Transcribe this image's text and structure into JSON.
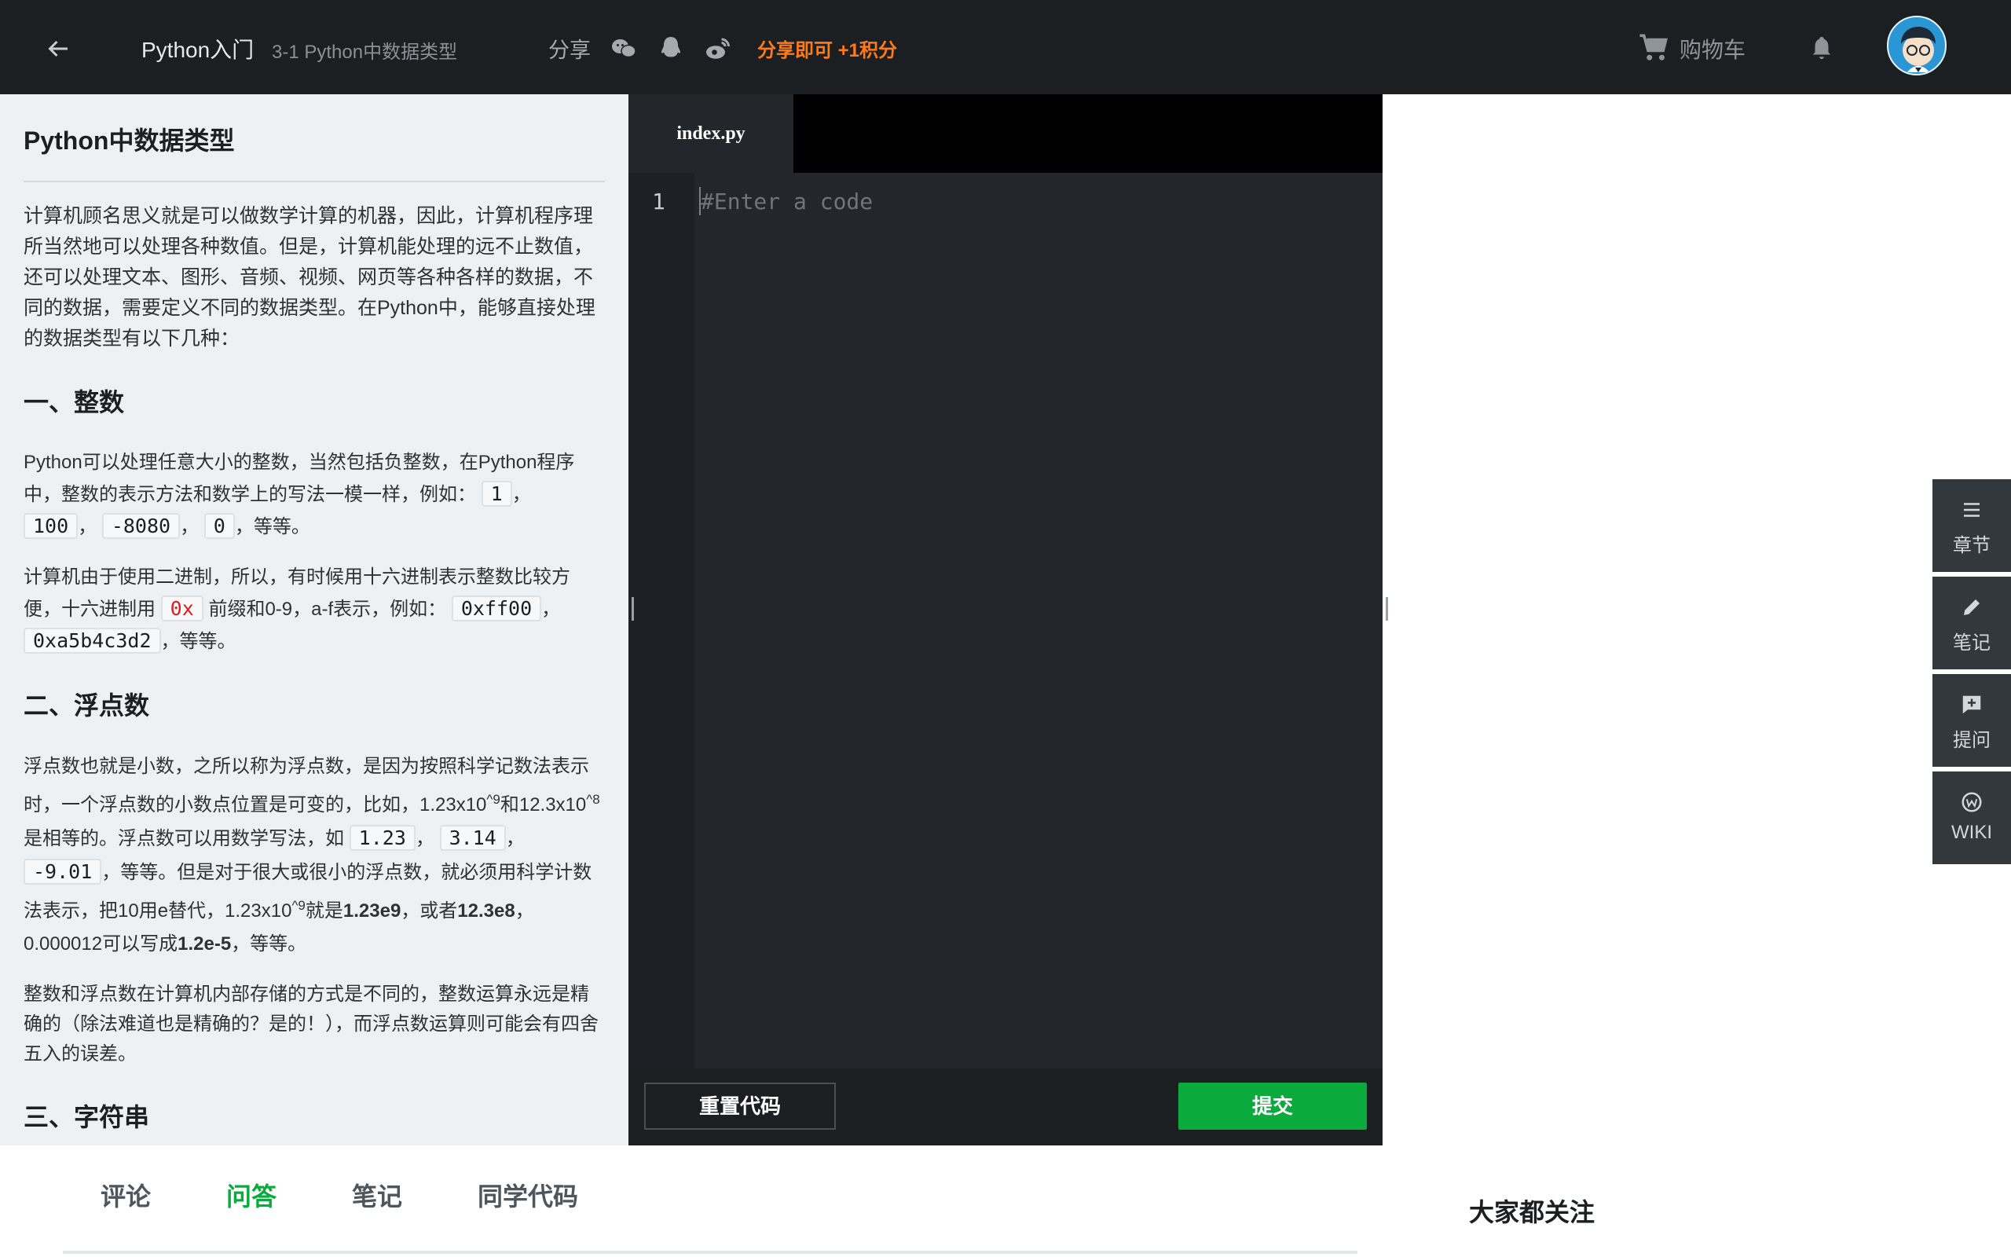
{
  "header": {
    "course_title": "Python入门",
    "lesson_subtitle": "3-1 Python中数据类型",
    "share_label": "分享",
    "share_promo": "分享即可 +1积分",
    "cart_label": "购物车"
  },
  "lesson": {
    "title": "Python中数据类型",
    "intro": "计算机顾名思义就是可以做数学计算的机器，因此，计算机程序理所当然地可以处理各种数值。但是，计算机能处理的远不止数值，还可以处理文本、图形、音频、视频、网页等各种各样的数据，不同的数据，需要定义不同的数据类型。在Python中，能够直接处理的数据类型有以下几种：",
    "h_int": "一、整数",
    "int_p1_a": "Python可以处理任意大小的整数，当然包括负整数，在Python程序中，整数的表示方法和数学上的写法一模一样，例如：",
    "int_codes": [
      "1",
      "100",
      "-8080",
      "0"
    ],
    "int_p1_end": "，等等。",
    "int_p2_a": "计算机由于使用二进制，所以，有时候用十六进制表示整数比较方便，十六进制用",
    "hex_prefix": "0x",
    "int_p2_b": "前缀和0-9，a-f表示，例如：",
    "hex_codes": [
      "0xff00",
      "0xa5b4c3d2"
    ],
    "int_p2_end": "，等等。",
    "h_float": "二、浮点数",
    "float_p1_a": "浮点数也就是小数，之所以称为浮点数，是因为按照科学记数法表示时，一个浮点数的小数点位置是可变的，比如，1.23x10",
    "sup_9": "^9",
    "float_p1_b": "和12.3x10",
    "sup_8": "^8",
    "float_p1_c": "是相等的。浮点数可以用数学写法，如",
    "float_codes": [
      "1.23",
      "3.14",
      "-9.01"
    ],
    "float_p1_d": "，等等。但是对于很大或很小的浮点数，就必须用科学计数法表示，把10用e替代，1.23x10",
    "float_p1_e": "就是",
    "sci_1": "1.23e9",
    "float_p1_f": "，或者",
    "sci_2": "12.3e8",
    "float_p1_g": "，0.000012可以写成",
    "sci_3": "1.2e-5",
    "float_p1_h": "，等等。",
    "float_p2": "整数和浮点数在计算机内部存储的方式是不同的，整数运算永远是精确的（除法难道也是精确的？是的！），而浮点数运算则可能会有四舍五入的误差。",
    "h_str": "三、字符串"
  },
  "editor": {
    "file_tab": "index.py",
    "line_number": "1",
    "placeholder": "#Enter a code",
    "reset_label": "重置代码",
    "submit_label": "提交"
  },
  "sidebar_tools": [
    {
      "label": "章节",
      "icon": "menu-icon"
    },
    {
      "label": "笔记",
      "icon": "pencil-icon"
    },
    {
      "label": "提问",
      "icon": "question-add-icon"
    },
    {
      "label": "WIKI",
      "icon": "wiki-icon"
    }
  ],
  "bottom_tabs": [
    "评论",
    "问答",
    "笔记",
    "同学代码"
  ],
  "active_bottom_tab": "问答",
  "aside_title": "大家都关注",
  "colors": {
    "accent_green": "#0aab3c",
    "promo_orange": "#ff7a1a",
    "topbar": "#1c1f21",
    "editor_bg": "#23272b"
  }
}
